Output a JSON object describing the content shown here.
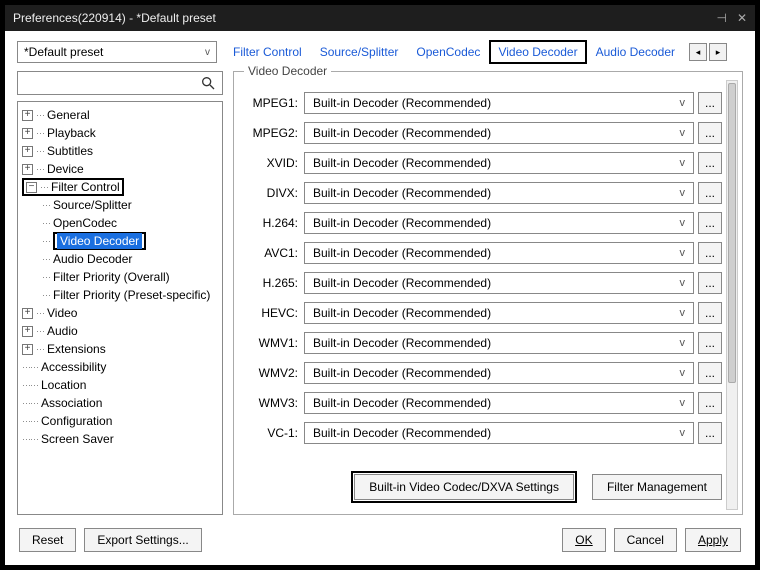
{
  "window": {
    "title": "Preferences(220914) - *Default preset"
  },
  "preset": {
    "selected": "*Default preset"
  },
  "tabs": {
    "filter_control": "Filter Control",
    "source_splitter": "Source/Splitter",
    "open_codec": "OpenCodec",
    "video_decoder": "Video Decoder",
    "audio_decoder": "Audio Decoder"
  },
  "tree": {
    "general": "General",
    "playback": "Playback",
    "subtitles": "Subtitles",
    "device": "Device",
    "filter_control": "Filter Control",
    "fc_source_splitter": "Source/Splitter",
    "fc_open_codec": "OpenCodec",
    "fc_video_decoder": "Video Decoder",
    "fc_audio_decoder": "Audio Decoder",
    "fc_filter_priority_overall": "Filter Priority (Overall)",
    "fc_filter_priority_preset": "Filter Priority (Preset-specific)",
    "video": "Video",
    "audio": "Audio",
    "extensions": "Extensions",
    "accessibility": "Accessibility",
    "location": "Location",
    "association": "Association",
    "configuration": "Configuration",
    "screen_saver": "Screen Saver"
  },
  "panel": {
    "title": "Video Decoder",
    "decoders": [
      {
        "label": "MPEG1:",
        "value": "Built-in Decoder (Recommended)"
      },
      {
        "label": "MPEG2:",
        "value": "Built-in Decoder (Recommended)"
      },
      {
        "label": "XVID:",
        "value": "Built-in Decoder (Recommended)"
      },
      {
        "label": "DIVX:",
        "value": "Built-in Decoder (Recommended)"
      },
      {
        "label": "H.264:",
        "value": "Built-in Decoder (Recommended)"
      },
      {
        "label": "AVC1:",
        "value": "Built-in Decoder (Recommended)"
      },
      {
        "label": "H.265:",
        "value": "Built-in Decoder (Recommended)"
      },
      {
        "label": "HEVC:",
        "value": "Built-in Decoder (Recommended)"
      },
      {
        "label": "WMV1:",
        "value": "Built-in Decoder (Recommended)"
      },
      {
        "label": "WMV2:",
        "value": "Built-in Decoder (Recommended)"
      },
      {
        "label": "WMV3:",
        "value": "Built-in Decoder (Recommended)"
      },
      {
        "label": "VC-1:",
        "value": "Built-in Decoder (Recommended)"
      }
    ],
    "dxva_btn": "Built-in Video Codec/DXVA Settings",
    "filter_mgmt_btn": "Filter Management"
  },
  "footer": {
    "reset": "Reset",
    "export": "Export Settings...",
    "ok": "OK",
    "cancel": "Cancel",
    "apply": "Apply"
  },
  "glyphs": {
    "caret": "v",
    "dots": "...",
    "left": "◂",
    "right": "▸"
  }
}
